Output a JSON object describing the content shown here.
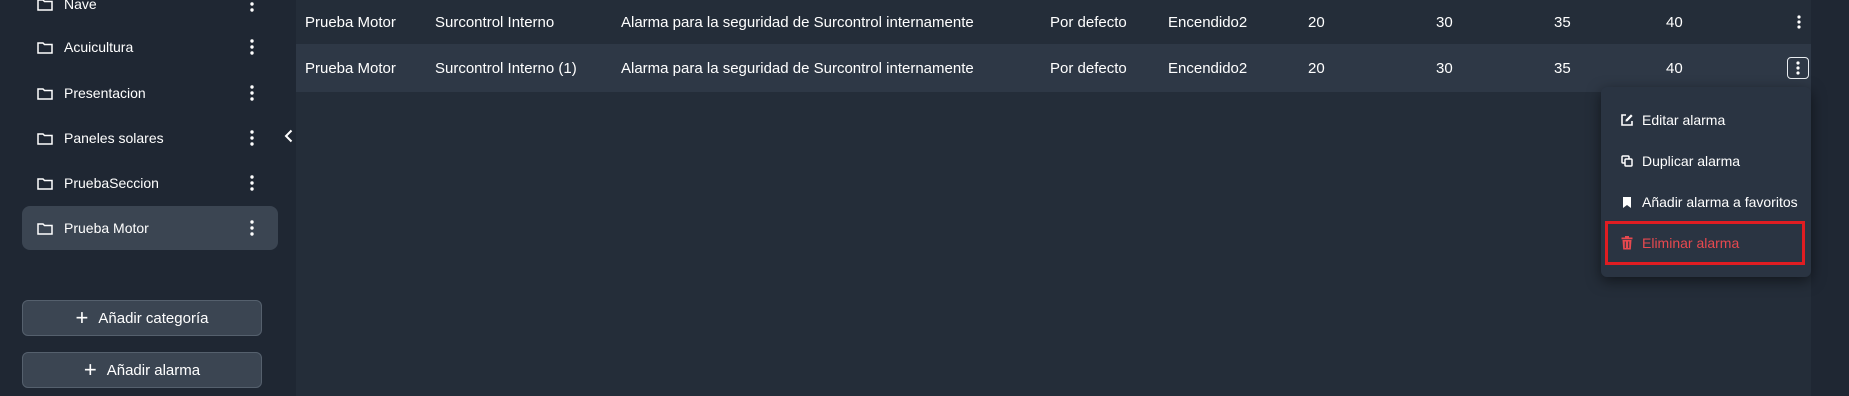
{
  "sidebar": {
    "items": [
      {
        "label": "Nave"
      },
      {
        "label": "Acuicultura"
      },
      {
        "label": "Presentacion"
      },
      {
        "label": "Paneles solares"
      },
      {
        "label": "PruebaSeccion"
      },
      {
        "label": "Prueba Motor"
      }
    ],
    "add_category_label": "Añadir categoría",
    "add_alarm_label": "Añadir alarma"
  },
  "table": {
    "rows": [
      {
        "name": "Prueba Motor",
        "source": "Surcontrol Interno",
        "description": "Alarma para la seguridad de Surcontrol internamente",
        "profile": "Por defecto",
        "signal": "Encendido2",
        "v1": "20",
        "v2": "30",
        "v3": "35",
        "v4": "40"
      },
      {
        "name": "Prueba Motor",
        "source": "Surcontrol Interno (1)",
        "description": "Alarma para la seguridad de Surcontrol internamente",
        "profile": "Por defecto",
        "signal": "Encendido2",
        "v1": "20",
        "v2": "30",
        "v3": "35",
        "v4": "40"
      }
    ]
  },
  "menu": {
    "edit_label": "Editar alarma",
    "duplicate_label": "Duplicar alarma",
    "favorite_label": "Añadir alarma a favoritos",
    "delete_label": "Eliminar alarma"
  },
  "colors": {
    "background": "#1f2733",
    "row_highlight": "#2e3846",
    "danger": "#e8494f",
    "highlight_frame": "#e01d22"
  }
}
